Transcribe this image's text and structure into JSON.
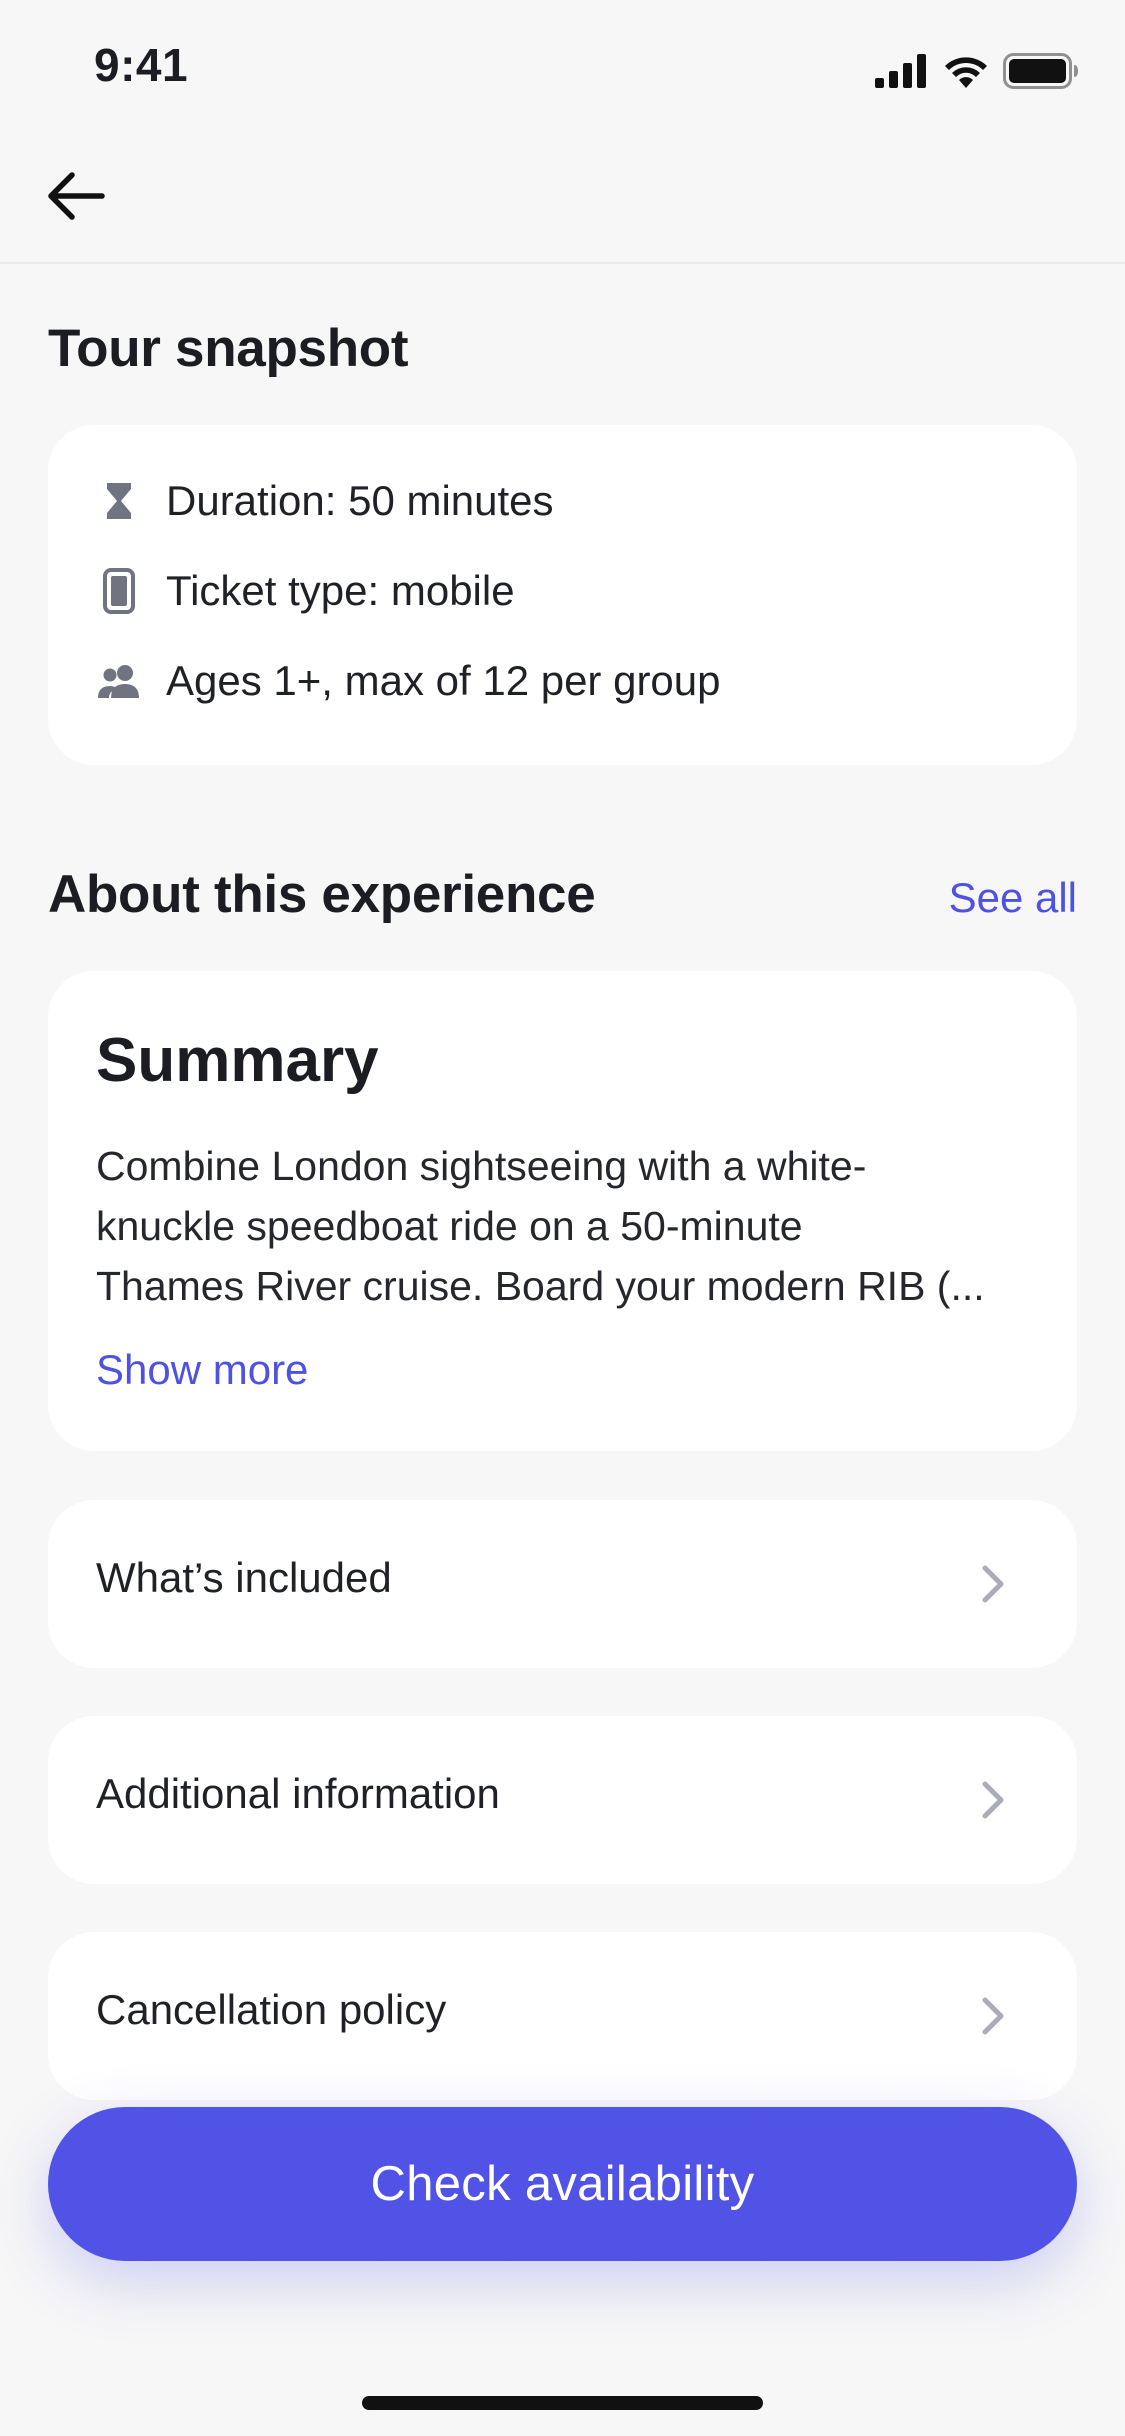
{
  "status_bar": {
    "time": "9:41"
  },
  "tour_snapshot": {
    "title": "Tour snapshot",
    "items": [
      {
        "icon": "hourglass-icon",
        "text": "Duration: 50 minutes"
      },
      {
        "icon": "mobile-ticket-icon",
        "text": "Ticket type: mobile"
      },
      {
        "icon": "group-icon",
        "text": "Ages 1+, max of 12 per group"
      }
    ]
  },
  "about": {
    "title": "About this experience",
    "see_all": "See all",
    "summary": {
      "title": "Summary",
      "lines": [
        "Combine London sightseeing with a white-",
        "knuckle speedboat ride on a 50-minute",
        "Thames River cruise. Board your modern RIB (..."
      ],
      "show_more": "Show more"
    },
    "sections": [
      {
        "label": "What’s included"
      },
      {
        "label": "Additional information"
      },
      {
        "label": "Cancellation policy"
      }
    ]
  },
  "cta": {
    "label": "Check availability"
  },
  "colors": {
    "accent": "#5053e6",
    "link": "#4e52e3",
    "background": "#f7f7f7",
    "card": "#ffffff",
    "icon": "#6f7480"
  }
}
